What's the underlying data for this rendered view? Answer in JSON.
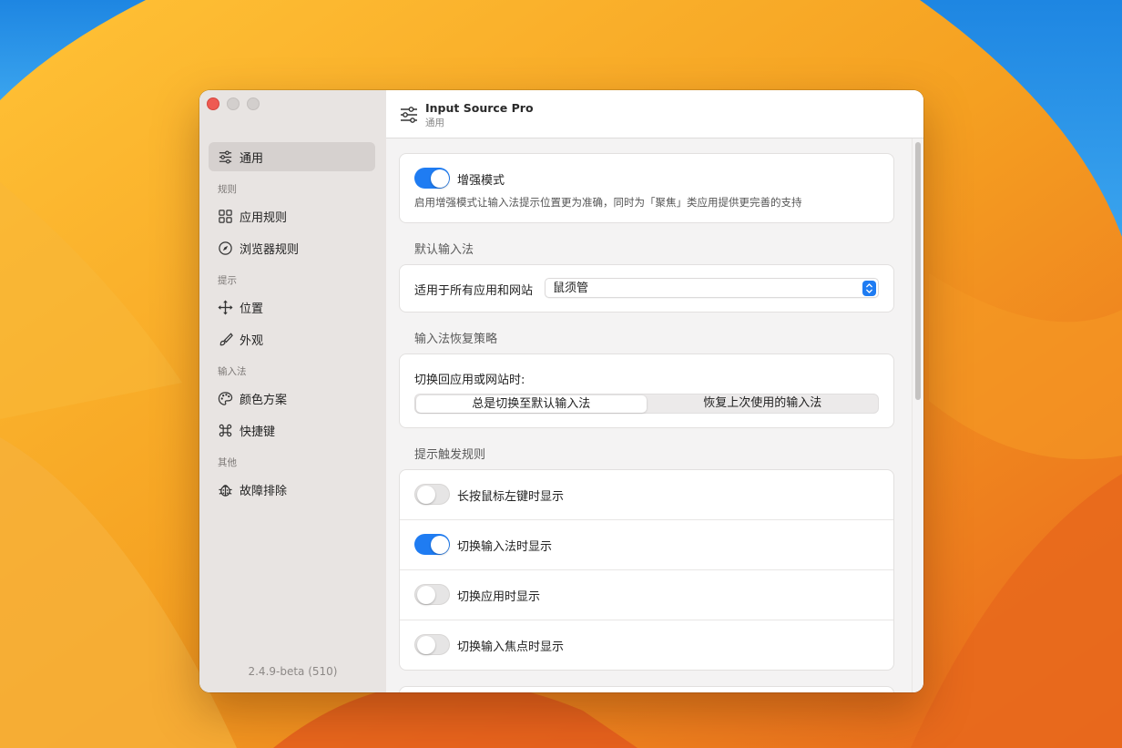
{
  "window": {
    "version": "2.4.9-beta (510)"
  },
  "toolbar": {
    "title": "Input Source Pro",
    "subtitle": "通用"
  },
  "sidebar": {
    "items": [
      {
        "label": "通用",
        "icon": "sliders-icon"
      },
      {
        "section": "规则"
      },
      {
        "label": "应用规则",
        "icon": "grid-icon"
      },
      {
        "label": "浏览器规则",
        "icon": "compass-icon"
      },
      {
        "section": "提示"
      },
      {
        "label": "位置",
        "icon": "move-arrows-icon"
      },
      {
        "label": "外观",
        "icon": "paintbrush-icon"
      },
      {
        "section": "输入法"
      },
      {
        "label": "颜色方案",
        "icon": "palette-icon"
      },
      {
        "label": "快捷键",
        "icon": "command-key-icon"
      },
      {
        "section": "其他"
      },
      {
        "label": "故障排除",
        "icon": "ladybug-icon"
      }
    ]
  },
  "enhanced": {
    "title": "增强模式",
    "enabled": true,
    "description": "启用增强模式让输入法提示位置更为准确，同时为「聚焦」类应用提供更完善的支持"
  },
  "default_input": {
    "section_title": "默认输入法",
    "label": "适用于所有应用和网站",
    "selected": "鼠须管"
  },
  "restore": {
    "section_title": "输入法恢复策略",
    "label": "切换回应用或网站时:",
    "options": [
      "总是切换至默认输入法",
      "恢复上次使用的输入法"
    ],
    "selected_index": 0
  },
  "triggers": {
    "section_title": "提示触发规则",
    "items": [
      {
        "label": "长按鼠标左键时显示",
        "enabled": false
      },
      {
        "label": "切换输入法时显示",
        "enabled": true
      },
      {
        "label": "切换应用时显示",
        "enabled": false
      },
      {
        "label": "切换输入焦点时显示",
        "enabled": false
      }
    ]
  },
  "colors": {
    "accent": "#1f7cf2",
    "close": "#ee5a52"
  }
}
